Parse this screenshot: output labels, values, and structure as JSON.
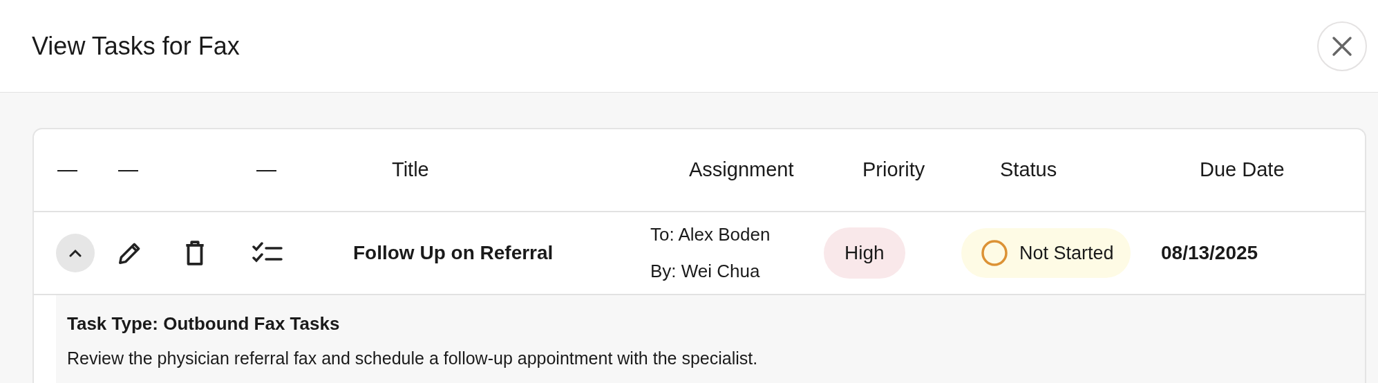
{
  "dialog": {
    "title": "View Tasks for Fax"
  },
  "table": {
    "columns": [
      "—",
      "—",
      "—",
      "Title",
      "Assignment",
      "Priority",
      "Status",
      "Due Date"
    ],
    "rows": [
      {
        "expanded": true,
        "title": "Follow Up on Referral",
        "assigned_to": "To: Alex Boden",
        "assigned_by": "By: Wei Chua",
        "priority": "High",
        "status": "Not Started",
        "due_date": "08/13/2025",
        "details": {
          "task_type": "Task Type: Outbound Fax Tasks",
          "description": "Review the physician referral fax and schedule a follow-up appointment with the specialist."
        }
      }
    ]
  }
}
